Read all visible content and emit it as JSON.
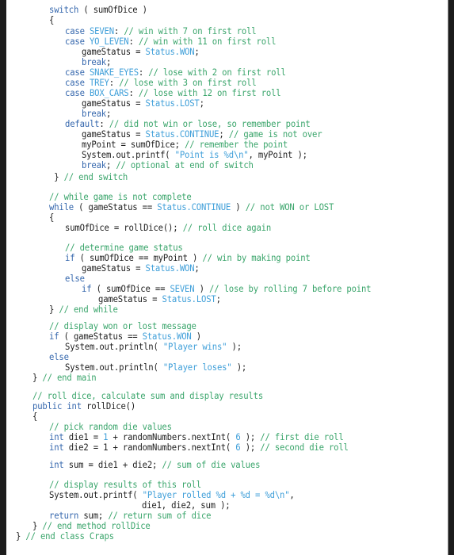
{
  "document": {
    "language": "Java",
    "colors": {
      "keyword": "#3567ad",
      "constant": "#3f9fd9",
      "comment": "#3aa56b",
      "string": "#3f9fd9",
      "text": "#1e1e1e",
      "frame": "#1c1c1c"
    },
    "lines": [
      {
        "indent": 3,
        "tokens": [
          [
            "kw",
            "switch"
          ],
          [
            "tx",
            " ( sumOfDice )"
          ]
        ]
      },
      {
        "indent": 3,
        "tokens": [
          [
            "tx",
            "{"
          ]
        ]
      },
      {
        "indent": 6,
        "tokens": [
          [
            "kw",
            "case "
          ],
          [
            "cn",
            "SEVEN"
          ],
          [
            "tx",
            ": "
          ],
          [
            "cm",
            "// win with 7 on first roll"
          ]
        ]
      },
      {
        "indent": 6,
        "tokens": [
          [
            "kw",
            "case "
          ],
          [
            "cn",
            "YO_LEVEN"
          ],
          [
            "tx",
            ": "
          ],
          [
            "cm",
            "// win with 11 on first roll"
          ]
        ]
      },
      {
        "indent": 9,
        "tokens": [
          [
            "tx",
            "gameStatus = "
          ],
          [
            "cn",
            "Status.WON"
          ],
          [
            "tx",
            ";"
          ]
        ]
      },
      {
        "indent": 9,
        "tokens": [
          [
            "kw",
            "break"
          ],
          [
            "tx",
            ";"
          ]
        ]
      },
      {
        "indent": 6,
        "tokens": [
          [
            "kw",
            "case "
          ],
          [
            "cn",
            "SNAKE_EYES"
          ],
          [
            "tx",
            ": "
          ],
          [
            "cm",
            "// lose with 2 on first roll"
          ]
        ]
      },
      {
        "indent": 6,
        "tokens": [
          [
            "kw",
            "case "
          ],
          [
            "cn",
            "TREY"
          ],
          [
            "tx",
            ": "
          ],
          [
            "cm",
            "// lose with 3 on first roll"
          ]
        ]
      },
      {
        "indent": 6,
        "tokens": [
          [
            "kw",
            "case "
          ],
          [
            "cn",
            "BOX_CARS"
          ],
          [
            "tx",
            ": "
          ],
          [
            "cm",
            "// lose with 12 on first roll"
          ]
        ]
      },
      {
        "indent": 9,
        "tokens": [
          [
            "tx",
            "gameStatus = "
          ],
          [
            "cn",
            "Status.LOST"
          ],
          [
            "tx",
            ";"
          ]
        ]
      },
      {
        "indent": 9,
        "tokens": [
          [
            "kw",
            "break"
          ],
          [
            "tx",
            ";"
          ]
        ]
      },
      {
        "indent": 6,
        "tokens": [
          [
            "kw",
            "default"
          ],
          [
            "tx",
            ": "
          ],
          [
            "cm",
            "// did not win or lose, so remember point"
          ]
        ]
      },
      {
        "indent": 9,
        "tokens": [
          [
            "tx",
            "gameStatus = "
          ],
          [
            "cn",
            "Status.CONTINUE"
          ],
          [
            "tx",
            "; "
          ],
          [
            "cm",
            "// game is not over"
          ]
        ]
      },
      {
        "indent": 9,
        "tokens": [
          [
            "tx",
            "myPoint = sumOfDice; "
          ],
          [
            "cm",
            "// remember the point"
          ]
        ]
      },
      {
        "indent": 9,
        "tokens": [
          [
            "tx",
            "System.out.printf( "
          ],
          [
            "st",
            "\"Point is %d\\n\""
          ],
          [
            "tx",
            ", myPoint );"
          ]
        ]
      },
      {
        "indent": 9,
        "tokens": [
          [
            "kw",
            "break"
          ],
          [
            "tx",
            "; "
          ],
          [
            "cm",
            "// optional at end of switch"
          ]
        ]
      },
      {
        "indent": 3,
        "tokens": [
          [
            "tx",
            " } "
          ],
          [
            "cm",
            "// end switch"
          ]
        ]
      },
      {
        "indent": 3,
        "tokens": [
          [
            "cm",
            "// while game is not complete"
          ]
        ]
      },
      {
        "indent": 3,
        "tokens": [
          [
            "kw",
            "while"
          ],
          [
            "tx",
            " ( gameStatus == "
          ],
          [
            "cn",
            "Status.CONTINUE"
          ],
          [
            "tx",
            " ) "
          ],
          [
            "cm",
            "// not WON or LOST"
          ]
        ]
      },
      {
        "indent": 3,
        "tokens": [
          [
            "tx",
            "{"
          ]
        ]
      },
      {
        "indent": 6,
        "tokens": [
          [
            "tx",
            "sumOfDice = rollDice(); "
          ],
          [
            "cm",
            "// roll dice again"
          ]
        ]
      },
      {
        "indent": 6,
        "tokens": [
          [
            "cm",
            "// determine game status"
          ]
        ]
      },
      {
        "indent": 6,
        "tokens": [
          [
            "kw",
            "if"
          ],
          [
            "tx",
            " ( sumOfDice == myPoint ) "
          ],
          [
            "cm",
            "// win by making point"
          ]
        ]
      },
      {
        "indent": 9,
        "tokens": [
          [
            "tx",
            "gameStatus = "
          ],
          [
            "cn",
            "Status.WON"
          ],
          [
            "tx",
            ";"
          ]
        ]
      },
      {
        "indent": 6,
        "tokens": [
          [
            "kw",
            "else"
          ]
        ]
      },
      {
        "indent": 9,
        "tokens": [
          [
            "kw",
            "if"
          ],
          [
            "tx",
            " ( sumOfDice == "
          ],
          [
            "cn",
            "SEVEN"
          ],
          [
            "tx",
            " ) "
          ],
          [
            "cm",
            "// lose by rolling 7 before point"
          ]
        ]
      },
      {
        "indent": 12,
        "tokens": [
          [
            "tx",
            "gameStatus = "
          ],
          [
            "cn",
            "Status.LOST"
          ],
          [
            "tx",
            ";"
          ]
        ]
      },
      {
        "indent": 3,
        "tokens": [
          [
            "tx",
            "} "
          ],
          [
            "cm",
            "// end while"
          ]
        ]
      },
      {
        "indent": 3,
        "tokens": [
          [
            "cm",
            "// display won or lost message"
          ]
        ]
      },
      {
        "indent": 3,
        "tokens": [
          [
            "kw",
            "if"
          ],
          [
            "tx",
            " ( gameStatus == "
          ],
          [
            "cn",
            "Status.WON"
          ],
          [
            "tx",
            " )"
          ]
        ]
      },
      {
        "indent": 6,
        "tokens": [
          [
            "tx",
            "System.out.println( "
          ],
          [
            "st",
            "\"Player wins\""
          ],
          [
            "tx",
            " );"
          ]
        ]
      },
      {
        "indent": 3,
        "tokens": [
          [
            "kw",
            "else"
          ]
        ]
      },
      {
        "indent": 6,
        "tokens": [
          [
            "tx",
            "System.out.println( "
          ],
          [
            "st",
            "\"Player loses\""
          ],
          [
            "tx",
            " );"
          ]
        ]
      },
      {
        "indent": 0,
        "tokens": [
          [
            "tx",
            "} "
          ],
          [
            "cm",
            "// end main"
          ]
        ]
      },
      {
        "indent": 0,
        "tokens": [
          [
            "cm",
            "// roll dice, calculate sum and display results"
          ]
        ]
      },
      {
        "indent": 0,
        "tokens": [
          [
            "kw",
            "public int"
          ],
          [
            "tx",
            " rollDice()"
          ]
        ]
      },
      {
        "indent": 0,
        "tokens": [
          [
            "tx",
            "{"
          ]
        ]
      },
      {
        "indent": 3,
        "tokens": [
          [
            "cm",
            "// pick random die values"
          ]
        ]
      },
      {
        "indent": 3,
        "tokens": [
          [
            "kw",
            "int"
          ],
          [
            "tx",
            " die1 = "
          ],
          [
            "cn",
            "1"
          ],
          [
            "tx",
            " + randomNumbers.nextInt( "
          ],
          [
            "cn",
            "6"
          ],
          [
            "tx",
            " ); "
          ],
          [
            "cm",
            "// first die roll"
          ]
        ]
      },
      {
        "indent": 3,
        "tokens": [
          [
            "kw",
            "int"
          ],
          [
            "tx",
            " die2 = 1 + randomNumbers.nextInt( "
          ],
          [
            "cn",
            "6"
          ],
          [
            "tx",
            " ); "
          ],
          [
            "cm",
            "// second die roll"
          ]
        ]
      },
      {
        "indent": 3,
        "tokens": [
          [
            "kw",
            "int"
          ],
          [
            "tx",
            " sum = die1 + die2; "
          ],
          [
            "cm",
            "// sum of die values"
          ]
        ]
      },
      {
        "indent": 3,
        "tokens": [
          [
            "cm",
            "// display results of this roll"
          ]
        ]
      },
      {
        "indent": 3,
        "tokens": [
          [
            "tx",
            "System.out.printf( "
          ],
          [
            "st",
            "\"Player rolled %d + %d = %d\\n\""
          ],
          [
            "tx",
            ","
          ]
        ]
      },
      {
        "indent": 20,
        "tokens": [
          [
            "tx",
            "die1, die2, sum );"
          ]
        ]
      },
      {
        "indent": 3,
        "tokens": [
          [
            "kw",
            "return"
          ],
          [
            "tx",
            " sum; "
          ],
          [
            "cm",
            "// return sum of dice"
          ]
        ]
      },
      {
        "indent": 0,
        "tokens": [
          [
            "tx",
            "} "
          ],
          [
            "cm",
            "// end method rollDice"
          ]
        ]
      },
      {
        "indent": -3,
        "tokens": [
          [
            "tx",
            "} "
          ],
          [
            "cm",
            "// end class Craps"
          ]
        ]
      }
    ]
  }
}
